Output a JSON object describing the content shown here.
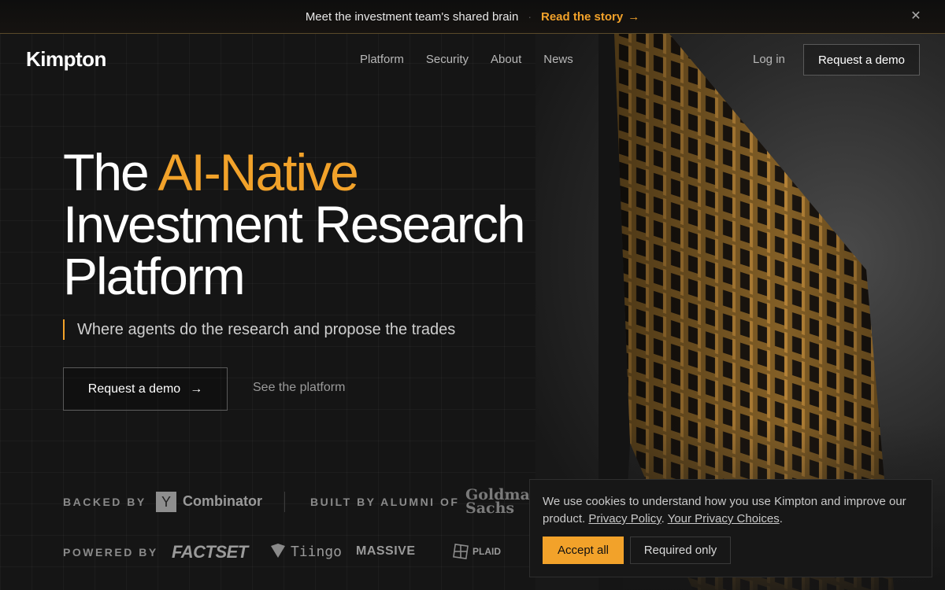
{
  "announcement": {
    "message": "Meet the investment team's shared brain",
    "link_label": "Read the story",
    "arrow_icon": "→",
    "close_icon": "✕"
  },
  "nav": {
    "logo": "Kimpton",
    "items": [
      "Platform",
      "Security",
      "About",
      "News"
    ],
    "login": "Log in",
    "demo": "Request a demo"
  },
  "hero": {
    "title_line1_prefix": "The",
    "title_accent": "AI-Native",
    "title_line2": "Investment Research",
    "title_line3": "Platform",
    "subtitle": "Where agents do the research and propose the trades",
    "cta_primary": "Request a demo",
    "cta_secondary": "See the platform"
  },
  "logos": {
    "backed_by_label": "BACKED BY",
    "yc_mark": "Y",
    "yc_name": "Combinator",
    "alumni_label": "BUILT BY ALUMNI OF",
    "goldman_line1": "Goldman",
    "goldman_line2": "Sachs",
    "powered_by_label": "POWERED BY",
    "factset": "FACTSET",
    "tiingo": "Tiingo",
    "massive": "MASSIVE",
    "plaid": "PLAID"
  },
  "cookie": {
    "text": "We use cookies to understand how you use Kimpton and improve our product.",
    "privacy_policy": "Privacy Policy",
    "privacy_choices": "Your Privacy Choices",
    "accept": "Accept all",
    "required": "Required only"
  },
  "colors": {
    "accent": "#f2a22a",
    "background": "#151515"
  }
}
